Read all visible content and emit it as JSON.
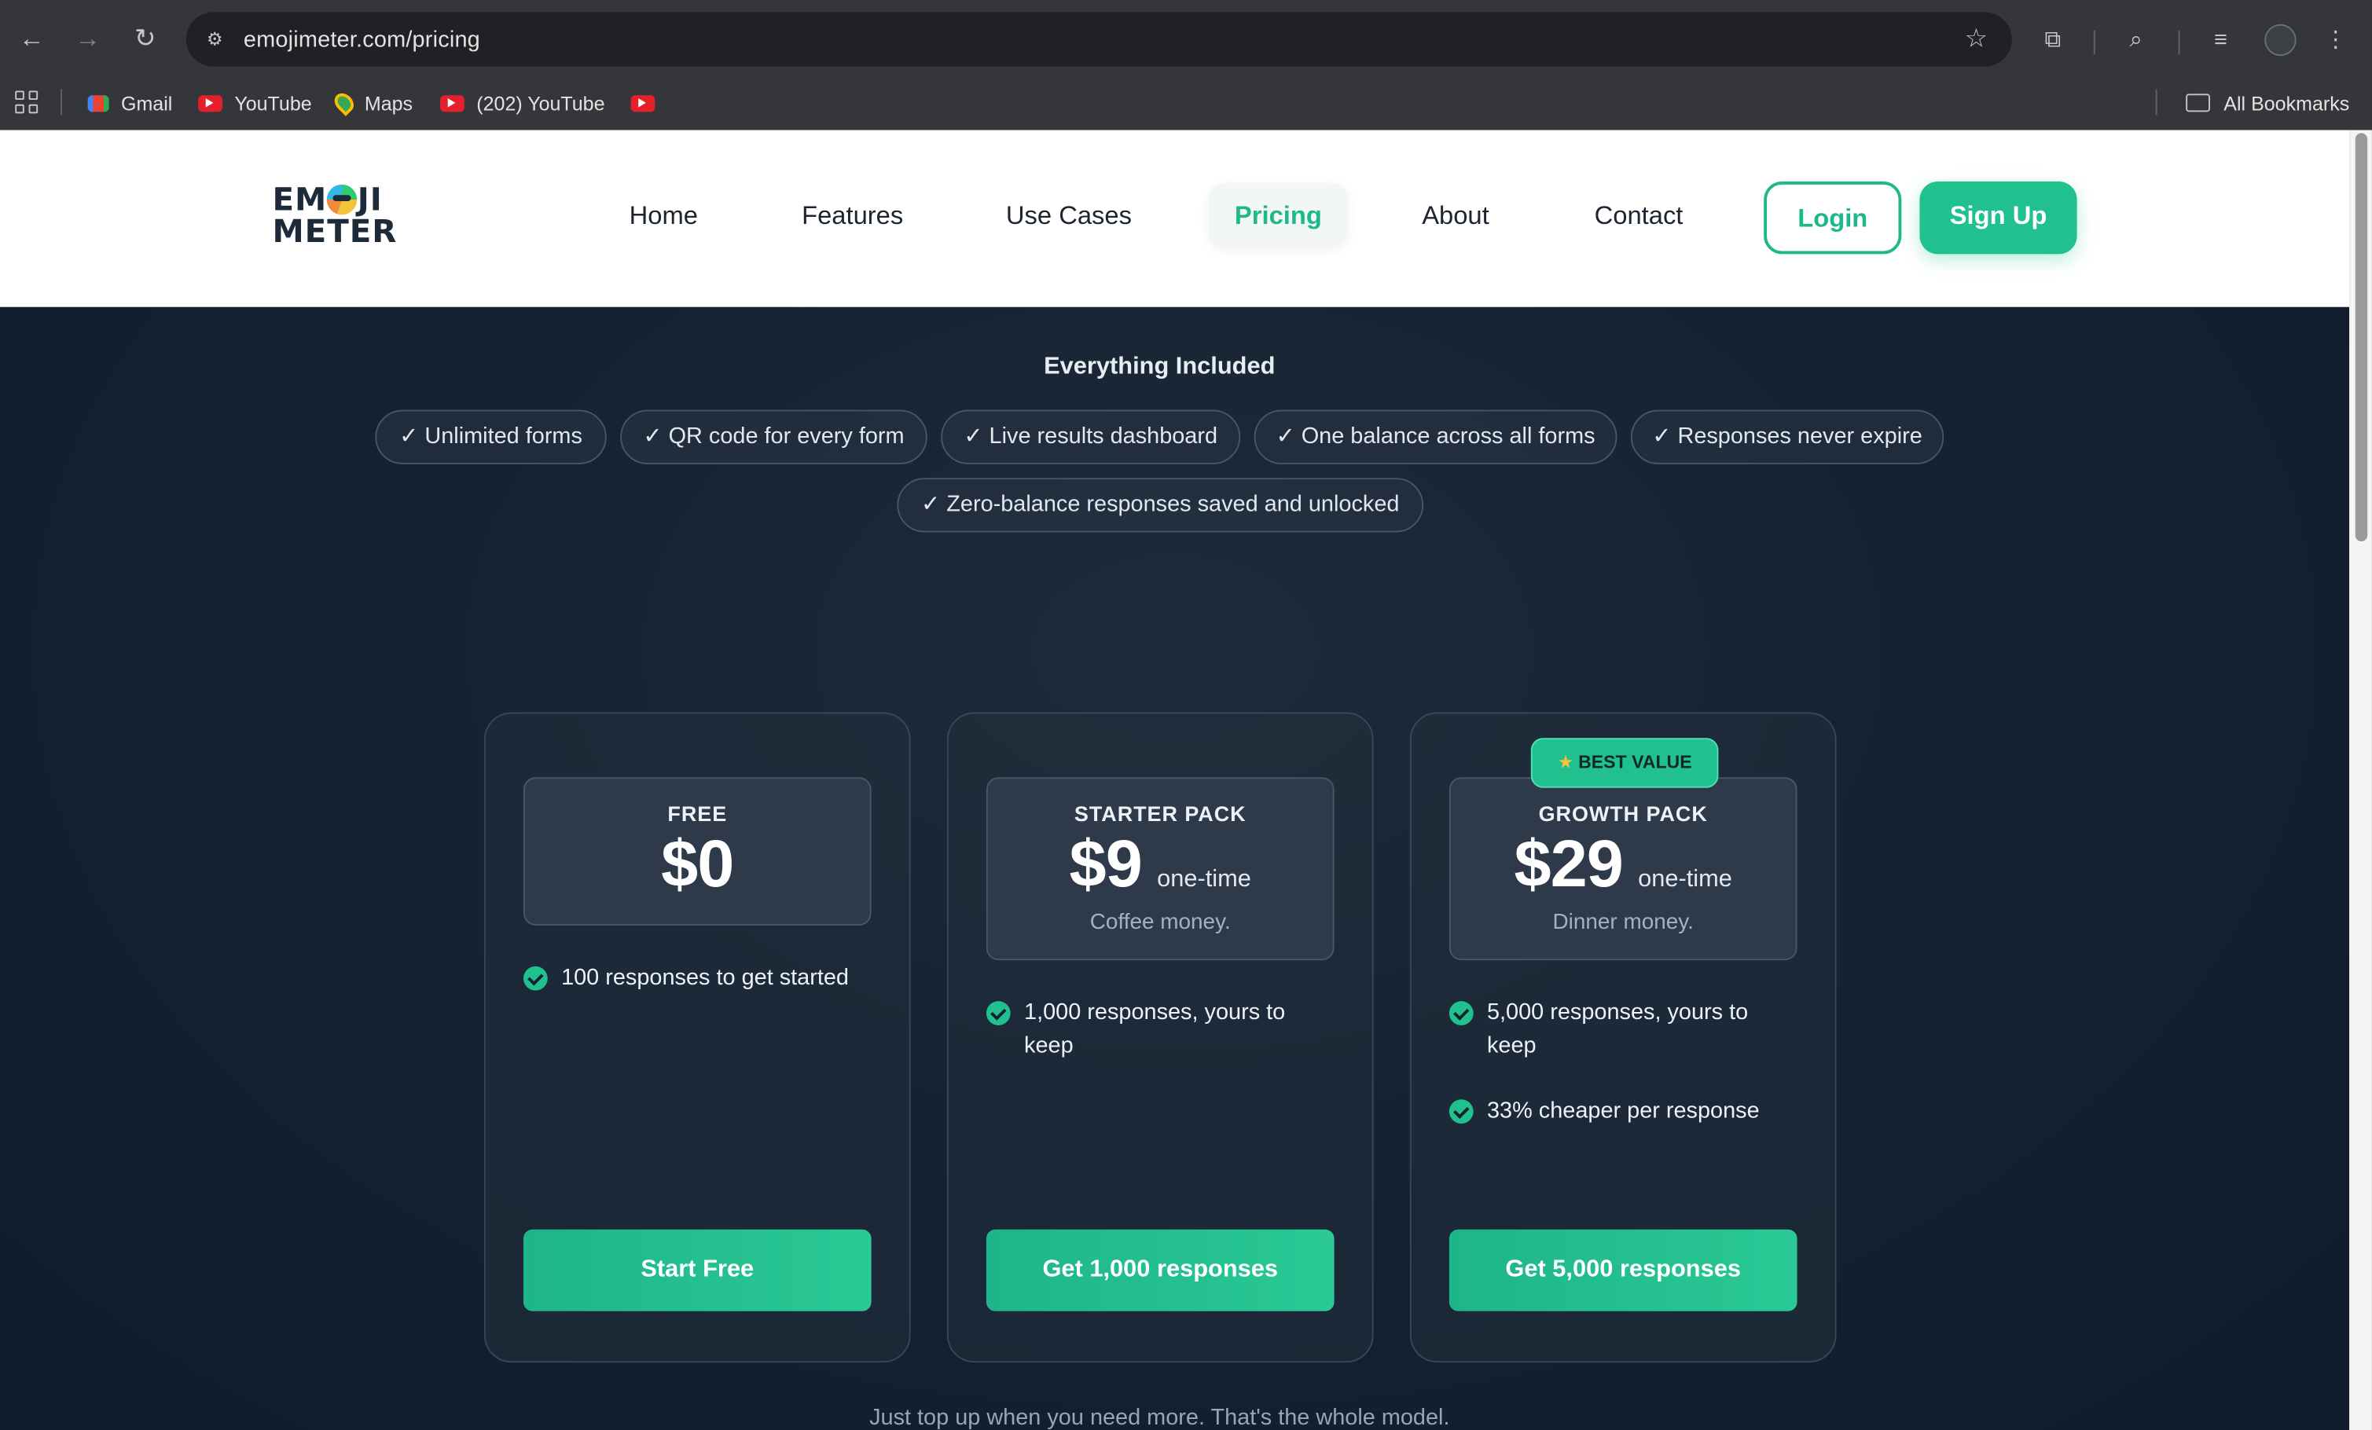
{
  "browser": {
    "url": "emojimeter.com/pricing",
    "bookmarks": [
      {
        "label": "Gmail",
        "icon": "gmail-icon"
      },
      {
        "label": "YouTube",
        "icon": "youtube-icon"
      },
      {
        "label": "Maps",
        "icon": "maps-icon"
      },
      {
        "label": "(202) YouTube",
        "icon": "youtube-icon"
      },
      {
        "label": "",
        "icon": "youtube-icon"
      }
    ],
    "all_bookmarks": "All Bookmarks"
  },
  "site": {
    "logo": {
      "line1_a": "EM",
      "line1_b": "JI",
      "line2": "METER"
    },
    "nav": [
      "Home",
      "Features",
      "Use Cases",
      "Pricing",
      "About",
      "Contact"
    ],
    "active_nav": "Pricing",
    "login": "Login",
    "signup": "Sign Up",
    "accent_color": "#21c08f"
  },
  "included": {
    "title": "Everything Included",
    "items": [
      "✓ Unlimited forms",
      "✓ QR code for every form",
      "✓ Live results dashboard",
      "✓ One balance across all forms",
      "✓ Responses never expire",
      "✓ Zero-balance responses saved and unlocked"
    ]
  },
  "plans": [
    {
      "name": "FREE",
      "price": "$0",
      "period": "",
      "tagline": "",
      "badge": "",
      "features": [
        "100 responses to get started"
      ],
      "cta": "Start Free"
    },
    {
      "name": "STARTER PACK",
      "price": "$9",
      "period": "one-time",
      "tagline": "Coffee money.",
      "badge": "",
      "features": [
        "1,000 responses, yours to keep"
      ],
      "cta": "Get 1,000 responses"
    },
    {
      "name": "GROWTH PACK",
      "price": "$29",
      "period": "one-time",
      "tagline": "Dinner money.",
      "badge": "BEST VALUE",
      "features": [
        "5,000 responses, yours to keep",
        "33% cheaper per response"
      ],
      "cta": "Get 5,000 responses"
    }
  ],
  "footnote": "Just top up when you need more. That's the whole model."
}
